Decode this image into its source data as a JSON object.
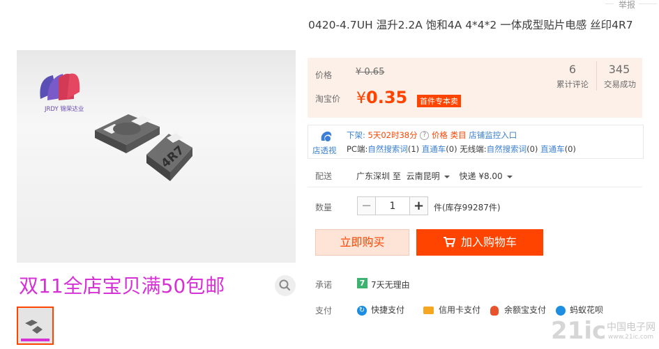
{
  "report": "举报",
  "title": "0420-4.7UH 温升2.2A 饱和4A 4*4*2 一体成型贴片电感 丝印4R7",
  "price": {
    "label": "价格",
    "old": "¥ 0.65",
    "taobao_label": "淘宝价",
    "currency": "¥",
    "new": "0.35",
    "badge": "首件专本卖"
  },
  "stats": [
    {
      "value": "6",
      "label": "累计评论"
    },
    {
      "value": "345",
      "label": "交易成功"
    }
  ],
  "toushi": {
    "icon_label": "店透视",
    "line1": {
      "off_label": "下架:",
      "time": "5天02时38分",
      "q": "?",
      "price": "价格",
      "category": "类目",
      "monitor": "店铺监控入口"
    },
    "line2": {
      "pc": "PC端:",
      "natural1": "自然搜索词",
      "n1": "(1)",
      "direct1": "直通车",
      "d1": "(0)",
      "wireless": "无线端:",
      "natural2": "自然搜索词",
      "n2": "(0)",
      "direct2": "直通车",
      "d2": "(0)"
    }
  },
  "delivery": {
    "label": "配送",
    "from": "广东深圳 至",
    "to": "云南昆明",
    "method": "快递 ¥8.00"
  },
  "quantity": {
    "label": "数量",
    "minus": "−",
    "value": "1",
    "plus": "+",
    "stock": "件(库存99287件)"
  },
  "buttons": {
    "buy_now": "立即购买",
    "add_cart": "加入购物车"
  },
  "promise": {
    "label": "承诺",
    "badge": "7",
    "text": "7天无理由"
  },
  "payment": {
    "label": "支付",
    "methods": [
      "快捷支付",
      "信用卡支付",
      "余额宝支付",
      "蚂蚁花呗"
    ]
  },
  "gallery": {
    "brand": "JRDY 锦荣达业",
    "part_mark": "4R7",
    "promo": "双11全店宝贝满50包邮"
  },
  "watermark": {
    "site": "21ic",
    "cn": "中国电子网",
    "url": "www.21ic.com"
  },
  "colors": {
    "accent": "#ff4400",
    "price_bg": "#fdf0e8",
    "promo": "#d630d6",
    "link": "#3a7fd5"
  }
}
